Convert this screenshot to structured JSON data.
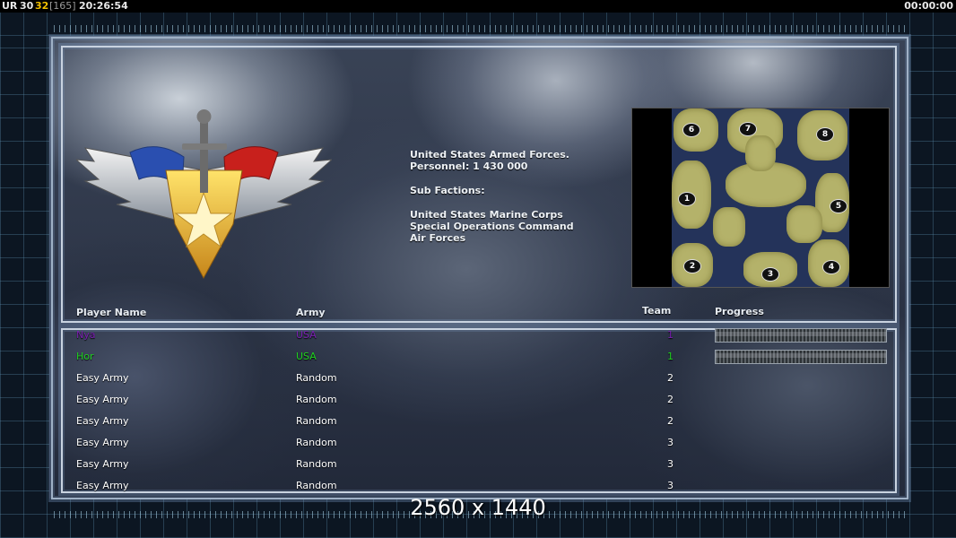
{
  "status_bar": {
    "label": "UR",
    "fps": "30",
    "count": "32",
    "bracket": "[165]",
    "clock": "20:26:54",
    "timer": "00:00:00"
  },
  "faction": {
    "name": "United States Armed Forces.",
    "personnel": "Personnel: 1 430 000",
    "sub_title": "Sub Factions:",
    "sub_factions": [
      "United States Marine Corps",
      "Special Operations Command",
      "Air Forces"
    ]
  },
  "map": {
    "markers": [
      "6",
      "7",
      "8",
      "1",
      "5",
      "2",
      "3",
      "4"
    ]
  },
  "table": {
    "headers": {
      "name": "Player Name",
      "army": "Army",
      "team": "Team",
      "progress": "Progress"
    },
    "rows": [
      {
        "name": "Nya",
        "army": "USA",
        "team": "1",
        "color": "#7a1fb0",
        "progress": true
      },
      {
        "name": "Hor",
        "army": "USA",
        "team": "1",
        "color": "#1fd11f",
        "progress": true
      },
      {
        "name": "Easy Army",
        "army": "Random",
        "team": "2",
        "color": "#ffffff",
        "progress": false
      },
      {
        "name": "Easy Army",
        "army": "Random",
        "team": "2",
        "color": "#ffffff",
        "progress": false
      },
      {
        "name": "Easy Army",
        "army": "Random",
        "team": "2",
        "color": "#ffffff",
        "progress": false
      },
      {
        "name": "Easy Army",
        "army": "Random",
        "team": "3",
        "color": "#ffffff",
        "progress": false
      },
      {
        "name": "Easy Army",
        "army": "Random",
        "team": "3",
        "color": "#ffffff",
        "progress": false
      },
      {
        "name": "Easy Army",
        "army": "Random",
        "team": "3",
        "color": "#ffffff",
        "progress": false
      }
    ]
  },
  "resolution": "2560 x 1440"
}
